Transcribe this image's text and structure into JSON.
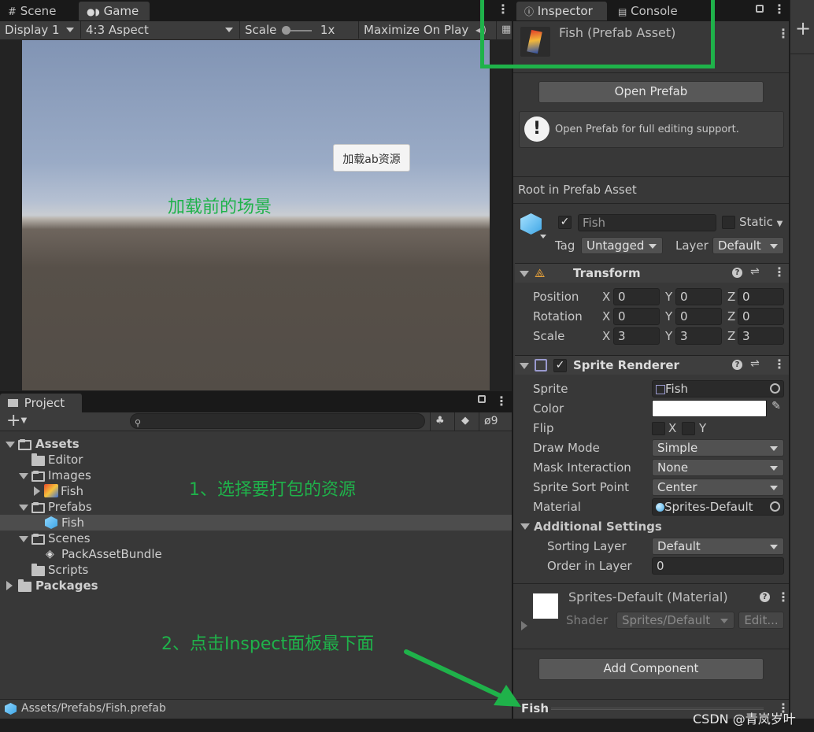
{
  "game_view": {
    "tabs": [
      {
        "label": "Scene",
        "icon": "grid-icon"
      },
      {
        "label": "Game",
        "icon": "gamepad-icon"
      }
    ],
    "display": "Display 1",
    "aspect": "4:3 Aspect",
    "scale_label": "Scale",
    "scale_value": "1x",
    "maximize": "Maximize On Play",
    "load_button": "加载ab资源",
    "scene_caption": "加载前的场景"
  },
  "project": {
    "tab": "Project",
    "hidden_count": "9",
    "tree": [
      {
        "label": "Assets",
        "bold": true
      },
      {
        "label": "Editor"
      },
      {
        "label": "Images"
      },
      {
        "label": "Fish"
      },
      {
        "label": "Prefabs"
      },
      {
        "label": "Fish"
      },
      {
        "label": "Scenes"
      },
      {
        "label": "PackAssetBundle"
      },
      {
        "label": "Scripts"
      },
      {
        "label": "Packages",
        "bold": true
      }
    ],
    "path": "Assets/Prefabs/Fish.prefab"
  },
  "inspector": {
    "tabs": [
      {
        "label": "Inspector",
        "icon": "info-icon"
      },
      {
        "label": "Console",
        "icon": "console-icon"
      }
    ],
    "title": "Fish (Prefab Asset)",
    "open_prefab": "Open Prefab",
    "help": "Open Prefab for full editing support.",
    "root_label": "Root in Prefab Asset",
    "object_name": "Fish",
    "static_label": "Static",
    "tag_label": "Tag",
    "tag_value": "Untagged",
    "layer_label": "Layer",
    "layer_value": "Default",
    "transform": {
      "title": "Transform",
      "rows": [
        {
          "label": "Position",
          "x": "0",
          "y": "0",
          "z": "0"
        },
        {
          "label": "Rotation",
          "x": "0",
          "y": "0",
          "z": "0"
        },
        {
          "label": "Scale",
          "x": "3",
          "y": "3",
          "z": "3"
        }
      ],
      "axis_x": "X",
      "axis_y": "Y",
      "axis_z": "Z"
    },
    "sprite_renderer": {
      "title": "Sprite Renderer",
      "sprite_label": "Sprite",
      "sprite_value": "Fish",
      "color_label": "Color",
      "flip_label": "Flip",
      "flip_x": "X",
      "flip_y": "Y",
      "draw_mode_label": "Draw Mode",
      "draw_mode": "Simple",
      "mask_label": "Mask Interaction",
      "mask": "None",
      "sort_point_label": "Sprite Sort Point",
      "sort_point": "Center",
      "material_label": "Material",
      "material": "Sprites-Default",
      "additional": "Additional Settings",
      "sorting_layer_label": "Sorting Layer",
      "sorting_layer": "Default",
      "order_label": "Order in Layer",
      "order": "0"
    },
    "material": {
      "title": "Sprites-Default (Material)",
      "shader_label": "Shader",
      "shader": "Sprites/Default",
      "edit": "Edit..."
    },
    "add_component": "Add Component",
    "preview_name": "Fish"
  },
  "annotations": {
    "step1": "1、选择要打包的资源",
    "step2": "2、点击Inspect面板最下面",
    "watermark": "CSDN @青岚岁叶",
    "color": "#1fb24a"
  }
}
